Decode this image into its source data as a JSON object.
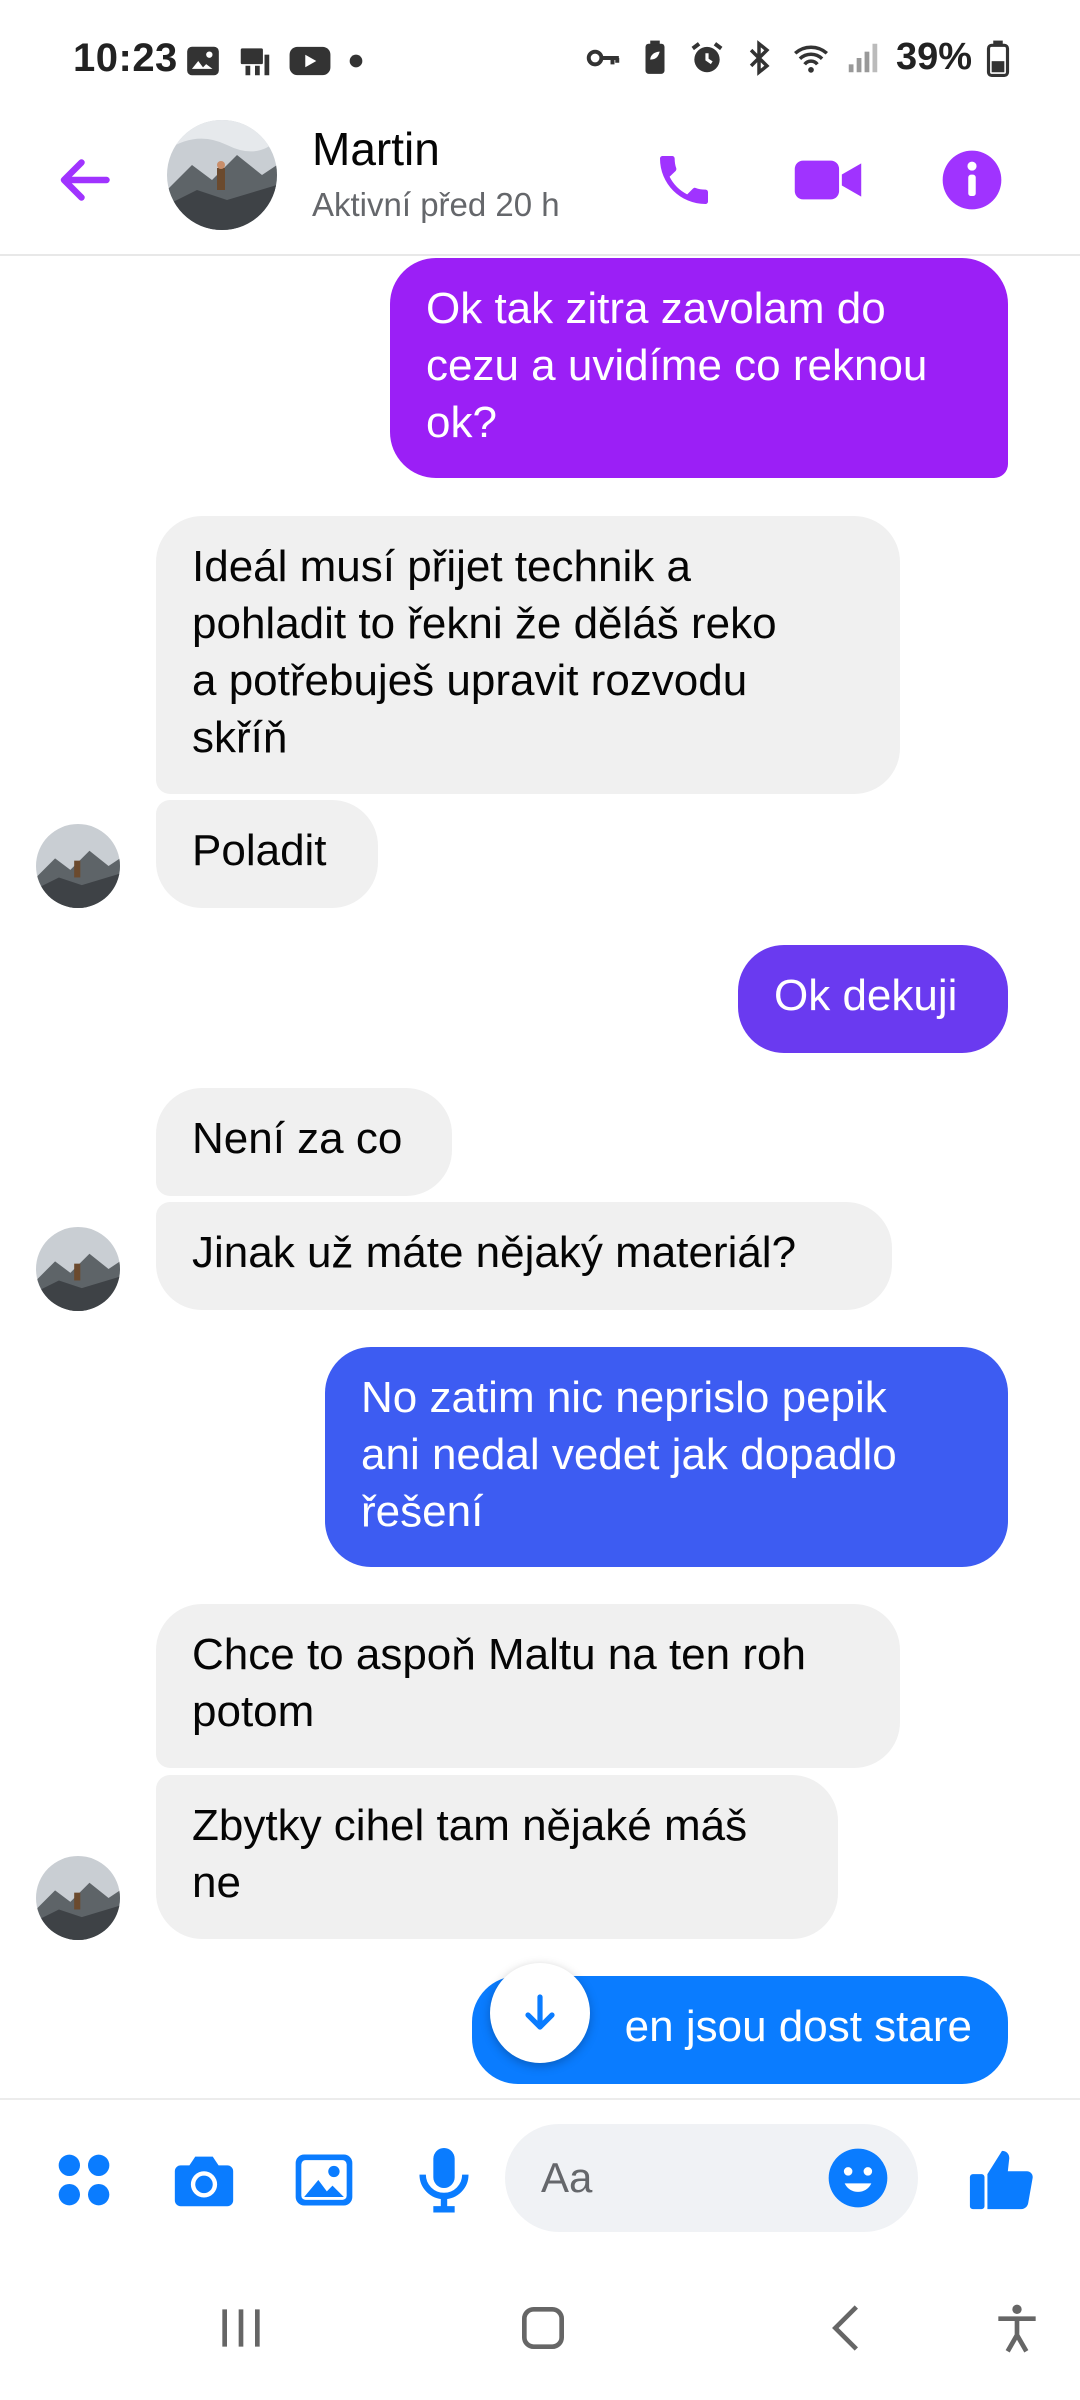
{
  "status_bar": {
    "time": "10:23",
    "battery": "39%",
    "left_icons": [
      "gallery-icon",
      "desk-icon",
      "youtube-icon",
      "dot-icon"
    ],
    "right_icons": [
      "key-icon",
      "battery-saver-icon",
      "alarm-icon",
      "bluetooth-icon",
      "wifi-icon",
      "signal-icon",
      "battery-icon"
    ]
  },
  "header": {
    "name": "Martin",
    "status": "Aktivní před 20 h"
  },
  "colors": {
    "accent": "#a033ff",
    "bubble_purple": "#9b1ff6",
    "bubble_violet": "#6a3af0",
    "bubble_blue": "#3d5cf2",
    "bubble_lightblue": "#0a7cff",
    "incoming": "#f0f0f0"
  },
  "messages": [
    {
      "dir": "out",
      "text": "Ok tak zitra zavolam do\ncezu a uvidíme co reknou\nok?"
    },
    {
      "dir": "in",
      "text": "Ideál musí přijet technik a\npohladit to řekni že děláš reko\na potřebuješ upravit rozvodu\nskříň"
    },
    {
      "dir": "in",
      "text": "Poladit"
    },
    {
      "dir": "out",
      "text": "Ok dekuji"
    },
    {
      "dir": "in",
      "text": "Není za co"
    },
    {
      "dir": "in",
      "text": "Jinak už máte nějaký materiál?"
    },
    {
      "dir": "out",
      "text": "No zatim nic neprislo pepik\nani nedal vedet jak dopadlo\nřešení"
    },
    {
      "dir": "in",
      "text": "Chce to aspoň Maltu na ten roh\npotom"
    },
    {
      "dir": "in",
      "text": "Zbytky cihel tam nějaké máš\nne"
    },
    {
      "dir": "out",
      "text": "en jsou dost stare"
    }
  ],
  "composer": {
    "placeholder": "Aa"
  }
}
